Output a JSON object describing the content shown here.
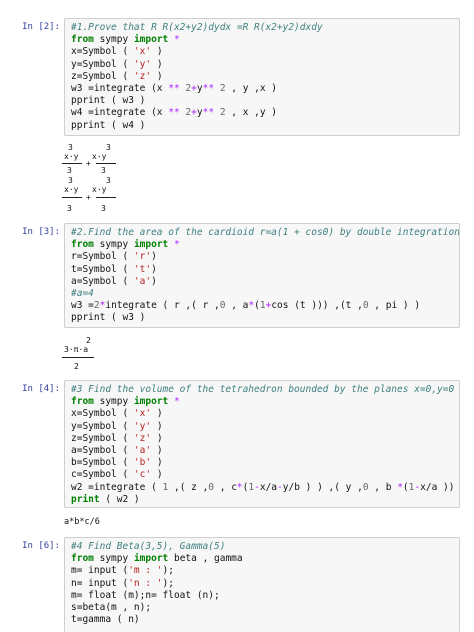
{
  "cells": [
    {
      "prompt": "In [2]:",
      "lines": [
        [
          [
            "cm",
            "#1.Prove that R R(x2+y2)dydx =R R(x2+y2)dxdy"
          ]
        ],
        [
          [
            "kw",
            "from"
          ],
          [
            "t",
            " sympy "
          ],
          [
            "kw",
            "import"
          ],
          [
            "op",
            " *"
          ]
        ],
        [
          [
            "t",
            "x=Symbol ( "
          ],
          [
            "st",
            "'x'"
          ],
          [
            "t",
            " )"
          ]
        ],
        [
          [
            "t",
            "y=Symbol ( "
          ],
          [
            "st",
            "'y'"
          ],
          [
            "t",
            " )"
          ]
        ],
        [
          [
            "t",
            "z=Symbol ( "
          ],
          [
            "st",
            "'z'"
          ],
          [
            "t",
            " )"
          ]
        ],
        [
          [
            "t",
            "w3 =integrate (x "
          ],
          [
            "op",
            "**"
          ],
          [
            "t",
            " "
          ],
          [
            "nu",
            "2"
          ],
          [
            "op",
            "+"
          ],
          [
            "t",
            "y"
          ],
          [
            "op",
            "**"
          ],
          [
            "t",
            " "
          ],
          [
            "nu",
            "2"
          ],
          [
            "t",
            " , y ,x )"
          ]
        ],
        [
          [
            "t",
            "pprint ( w3 )"
          ]
        ],
        [
          [
            "t",
            "w4 =integrate (x "
          ],
          [
            "op",
            "**"
          ],
          [
            "t",
            " "
          ],
          [
            "nu",
            "2"
          ],
          [
            "op",
            "+"
          ],
          [
            "t",
            "y"
          ],
          [
            "op",
            "**"
          ],
          [
            "t",
            " "
          ],
          [
            "nu",
            "2"
          ],
          [
            "t",
            " , x ,y )"
          ]
        ],
        [
          [
            "t",
            "pprint ( w4 )"
          ]
        ]
      ]
    },
    {
      "prompt": "In [3]:",
      "lines": [
        [
          [
            "cm",
            "#2.Find the area of the cardioid r=a(1 + cos0) by double integration"
          ]
        ],
        [
          [
            "kw",
            "from"
          ],
          [
            "t",
            " sympy "
          ],
          [
            "kw",
            "import"
          ],
          [
            "op",
            " *"
          ]
        ],
        [
          [
            "t",
            "r=Symbol ( "
          ],
          [
            "st",
            "'r'"
          ],
          [
            "t",
            ")"
          ]
        ],
        [
          [
            "t",
            "t=Symbol ( "
          ],
          [
            "st",
            "'t'"
          ],
          [
            "t",
            ")"
          ]
        ],
        [
          [
            "t",
            "a=Symbol ( "
          ],
          [
            "st",
            "'a'"
          ],
          [
            "t",
            ")"
          ]
        ],
        [
          [
            "cm",
            "#a=4"
          ]
        ],
        [
          [
            "t",
            "w3 ="
          ],
          [
            "nu",
            "2"
          ],
          [
            "op",
            "*"
          ],
          [
            "t",
            "integrate ( r ,( r ,"
          ],
          [
            "nu",
            "0"
          ],
          [
            "t",
            " , a"
          ],
          [
            "op",
            "*"
          ],
          [
            "t",
            "("
          ],
          [
            "nu",
            "1"
          ],
          [
            "op",
            "+"
          ],
          [
            "t",
            "cos (t ))) ,(t ,"
          ],
          [
            "nu",
            "0"
          ],
          [
            "t",
            " , pi ) )"
          ]
        ],
        [
          [
            "t",
            "pprint ( w3 )"
          ]
        ]
      ]
    },
    {
      "prompt": "In [4]:",
      "lines": [
        [
          [
            "cm",
            "#3 Find the volume of the tetrahedron bounded by the planes x=0,y=0 and z=0"
          ]
        ],
        [
          [
            "kw",
            "from"
          ],
          [
            "t",
            " sympy "
          ],
          [
            "kw",
            "import"
          ],
          [
            "op",
            " *"
          ]
        ],
        [
          [
            "t",
            "x=Symbol ( "
          ],
          [
            "st",
            "'x'"
          ],
          [
            "t",
            " )"
          ]
        ],
        [
          [
            "t",
            "y=Symbol ( "
          ],
          [
            "st",
            "'y'"
          ],
          [
            "t",
            " )"
          ]
        ],
        [
          [
            "t",
            "z=Symbol ( "
          ],
          [
            "st",
            "'z'"
          ],
          [
            "t",
            " )"
          ]
        ],
        [
          [
            "t",
            "a=Symbol ( "
          ],
          [
            "st",
            "'a'"
          ],
          [
            "t",
            " )"
          ]
        ],
        [
          [
            "t",
            "b=Symbol ( "
          ],
          [
            "st",
            "'b'"
          ],
          [
            "t",
            " )"
          ]
        ],
        [
          [
            "t",
            "c=Symbol ( "
          ],
          [
            "st",
            "'c'"
          ],
          [
            "t",
            " )"
          ]
        ],
        [
          [
            "t",
            "w2 =integrate ( "
          ],
          [
            "nu",
            "1"
          ],
          [
            "t",
            " ,( z ,"
          ],
          [
            "nu",
            "0"
          ],
          [
            "t",
            " , c"
          ],
          [
            "op",
            "*"
          ],
          [
            "t",
            "("
          ],
          [
            "nu",
            "1"
          ],
          [
            "op",
            "-"
          ],
          [
            "t",
            "x/a"
          ],
          [
            "op",
            "-"
          ],
          [
            "t",
            "y/b ) ) ,( y ,"
          ],
          [
            "nu",
            "0"
          ],
          [
            "t",
            " , b "
          ],
          [
            "op",
            "*"
          ],
          [
            "t",
            "("
          ],
          [
            "nu",
            "1"
          ],
          [
            "op",
            "-"
          ],
          [
            "t",
            "x/a )) ,(x ,"
          ],
          [
            "nu",
            "0"
          ]
        ],
        [
          [
            "kw",
            "print"
          ],
          [
            "t",
            " ( w2 )"
          ]
        ]
      ]
    },
    {
      "prompt": "In [6]:",
      "lines": [
        [
          [
            "cm",
            "#4 Find Beta(3,5), Gamma(5)"
          ]
        ],
        [
          [
            "kw",
            "from"
          ],
          [
            "t",
            " sympy "
          ],
          [
            "kw",
            "import"
          ],
          [
            "t",
            " beta , gamma"
          ]
        ],
        [
          [
            "t",
            "m= input ("
          ],
          [
            "st",
            "'m : '"
          ],
          [
            "t",
            ");"
          ]
        ],
        [
          [
            "t",
            "n= input ("
          ],
          [
            "st",
            "'n : '"
          ],
          [
            "t",
            ");"
          ]
        ],
        [
          [
            "t",
            "m= float (m);n= float (n);"
          ]
        ],
        [
          [
            "t",
            "s=beta(m , n);"
          ]
        ],
        [
          [
            "t",
            "t=gamma ( n)"
          ]
        ]
      ]
    }
  ],
  "outputs": {
    "out1": {
      "e1": {
        "n1": "3",
        "t1": "x·y",
        "d1": "3",
        "plus": "+",
        "n2": "3",
        "t2": "x·y",
        "d2": "3"
      },
      "e2": {
        "n1": "3",
        "t1": "x·y",
        "d1": "3",
        "plus": "+",
        "n2": "3",
        "t2": "x·y",
        "d2": "3"
      }
    },
    "out2": {
      "exp": "2",
      "num": "3·π·a",
      "den": "2"
    },
    "out3": "a*b*c/6"
  }
}
